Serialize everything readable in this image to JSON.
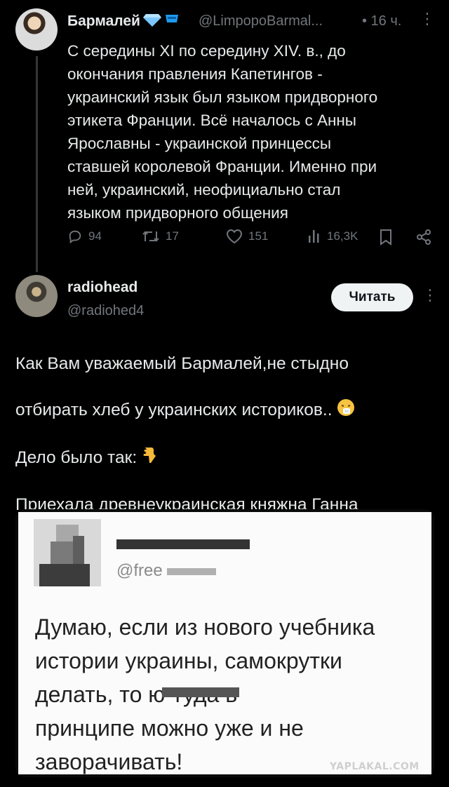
{
  "tweet1": {
    "name": "Бармалей",
    "handle": "@LimpopoBarmal...",
    "time": "• 16 ч.",
    "text": "С середины XI по середину XIV. в., до\nокончания правления  Капетингов -\nукраинский язык был языком придворного\nэтикета Франции. Всё началось с Анны\nЯрославны - украинской принцессы\nставшей королевой Франции. Именно при\nней, украинский, неофициально стал\nязыком придворного общения",
    "replies": "94",
    "retweets": "17",
    "likes": "151",
    "views": "16,3K",
    "icons": [
      "reply-icon",
      "retweet-icon",
      "like-icon",
      "views-icon",
      "bookmark-icon",
      "share-icon"
    ]
  },
  "tweet2": {
    "name": "radiohead",
    "handle": "@radiohed4",
    "follow_label": "Читать",
    "text_line1": "Как Вам уважаемый Бармалей,не стыдно",
    "text_line2": "отбирать хлеб у украинских историков..",
    "text_line3": "Дело было так:",
    "text_rest": "Приехала древнеукраинская княжна Ганна\nво Францию. Достала шмат сала и говорит\nместному царьку: «Порижь!» С тех пор\nместечко стало называться Парижем."
  },
  "embedded": {
    "handle": "@free",
    "text": "Думаю, если из нового учебника\nистории украины, самокрутки\nделать, то           ю-туда в\nпринципе можно уже и не\nзаворачивать!"
  },
  "watermark": "YAPLAKAL.COM",
  "colors": {
    "background": "#000000",
    "text": "#e7e9ea",
    "muted": "#71767b",
    "button": "#eff3f4"
  }
}
